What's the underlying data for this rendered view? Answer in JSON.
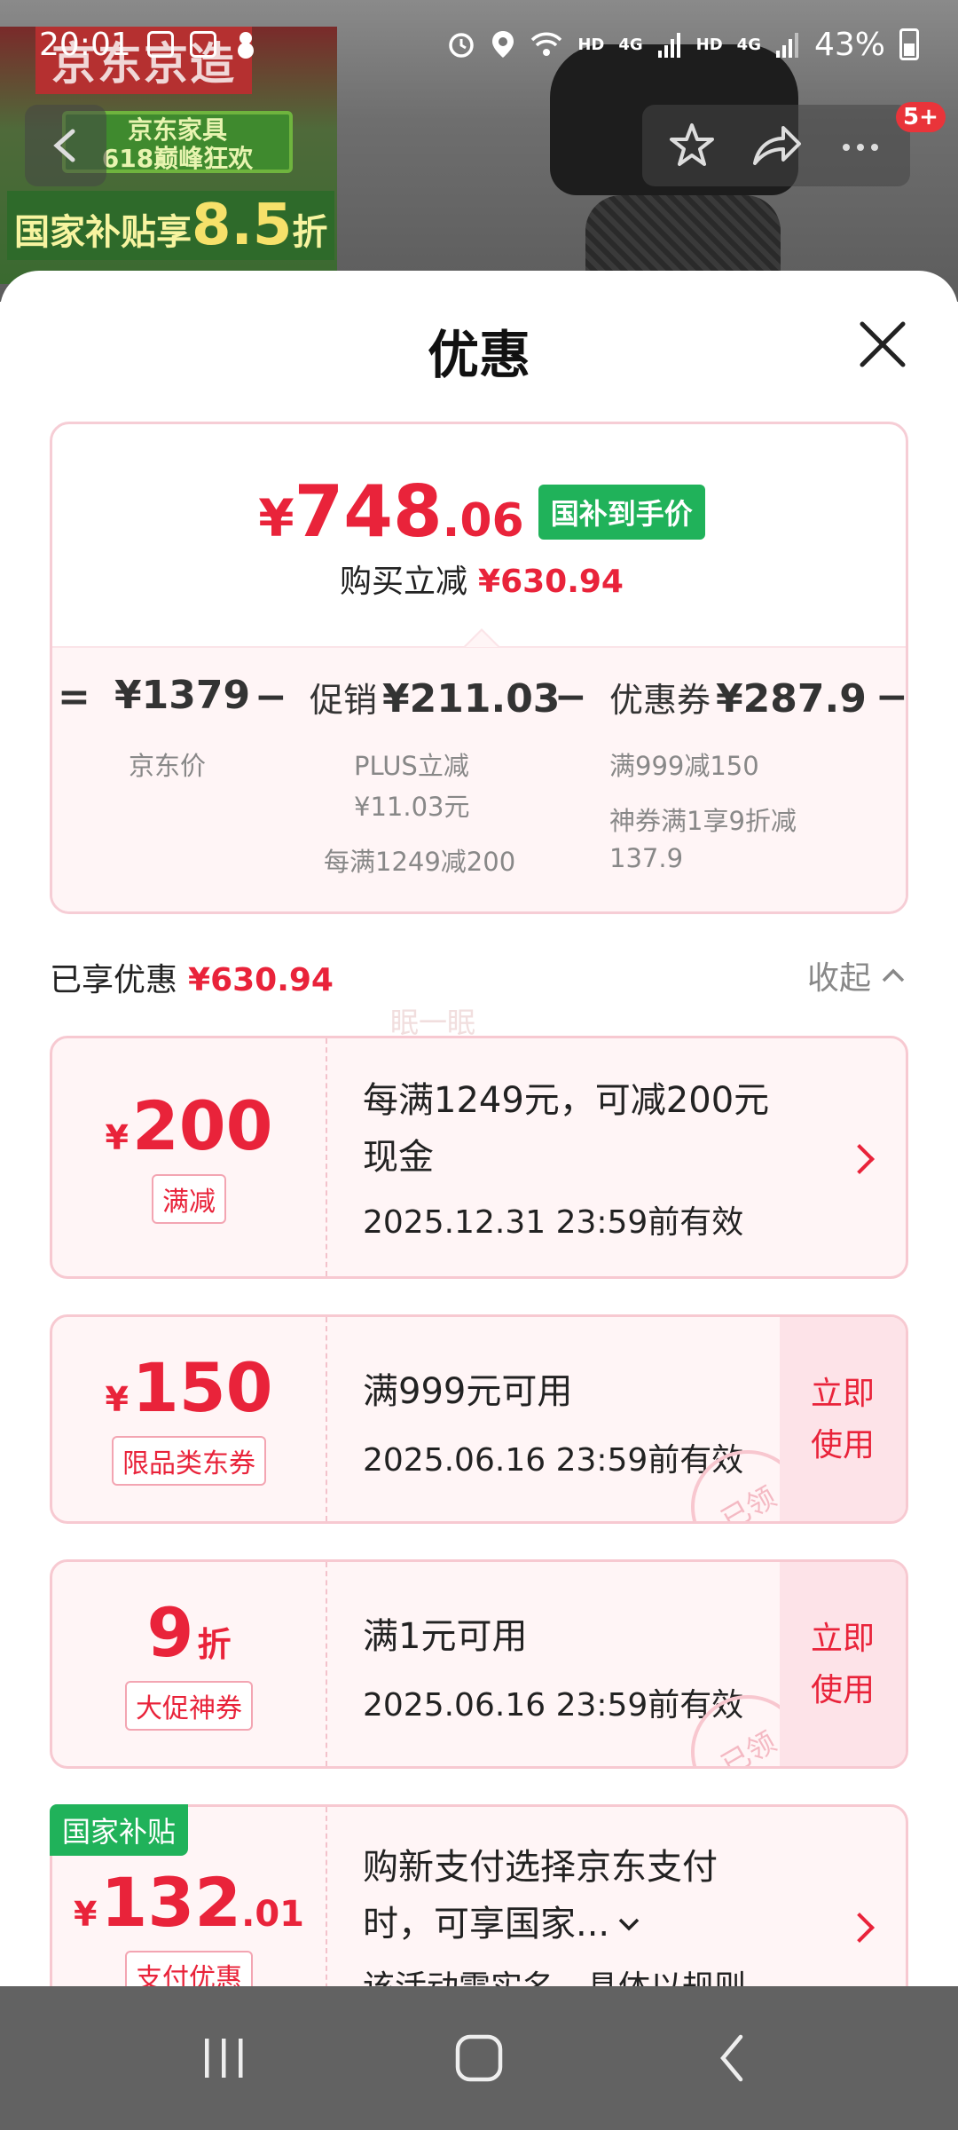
{
  "status_bar": {
    "time": "20:01",
    "net1": "HD",
    "net2": "4G",
    "net3": "HD",
    "net4": "4G",
    "battery": "43%"
  },
  "background": {
    "brand": "京东京造",
    "house_line1": "京东家具",
    "house_line2": "618巅峰狂欢",
    "subsidy_prefix": "国家补贴享",
    "subsidy_value": "8.5",
    "subsidy_suffix": "折",
    "badge": "5+"
  },
  "sheet": {
    "title": "优惠",
    "summary": {
      "price_yen": "¥",
      "price_int": "748",
      "price_dec": ".06",
      "price_tag": "国补到手价",
      "reduce_label": "购买立减",
      "reduce_value": "¥630.94",
      "eq": "=",
      "minus": "−",
      "jd_price": "¥1379",
      "jd_price_label": "京东价",
      "promo_label": "促销",
      "promo_value": "¥211.03",
      "promo_sub1": "PLUS立减",
      "promo_sub2": "¥11.03元",
      "promo_sub3": "每满1249减200",
      "coupon_label": "优惠券",
      "coupon_value": "¥287.9",
      "coupon_sub1": "满999减150",
      "coupon_sub2": "神券满1享9折减",
      "coupon_sub3": "137.9"
    },
    "enjoyed_label": "已享优惠",
    "enjoyed_value": "¥630.94",
    "collapse_label": "收起",
    "watermark": "眠一眠",
    "coupons": [
      {
        "yen": "¥",
        "amount": "200",
        "type": "满减",
        "line1": "每满1249元，可减200元",
        "line2": "现金",
        "date": "2025.12.31 23:59前有效"
      },
      {
        "yen": "¥",
        "amount": "150",
        "type": "限品类东券",
        "line1": "满999元可用",
        "date": "2025.06.16 23:59前有效",
        "action": "立即使用",
        "action_l1": "立即",
        "action_l2": "使用",
        "stamp": "已领"
      },
      {
        "amount": "9",
        "unit": "折",
        "type": "大促神券",
        "line1": "满1元可用",
        "date": "2025.06.16 23:59前有效",
        "action_l1": "立即",
        "action_l2": "使用",
        "stamp": "已领"
      },
      {
        "corner": "国家补贴",
        "yen": "¥",
        "amount": "132",
        "decimal": ".01",
        "type": "支付优惠",
        "line1": "购新支付选择京东支付",
        "line2": "时，可享国家...",
        "line3": "该活动需实名，具体以规则"
      }
    ]
  }
}
